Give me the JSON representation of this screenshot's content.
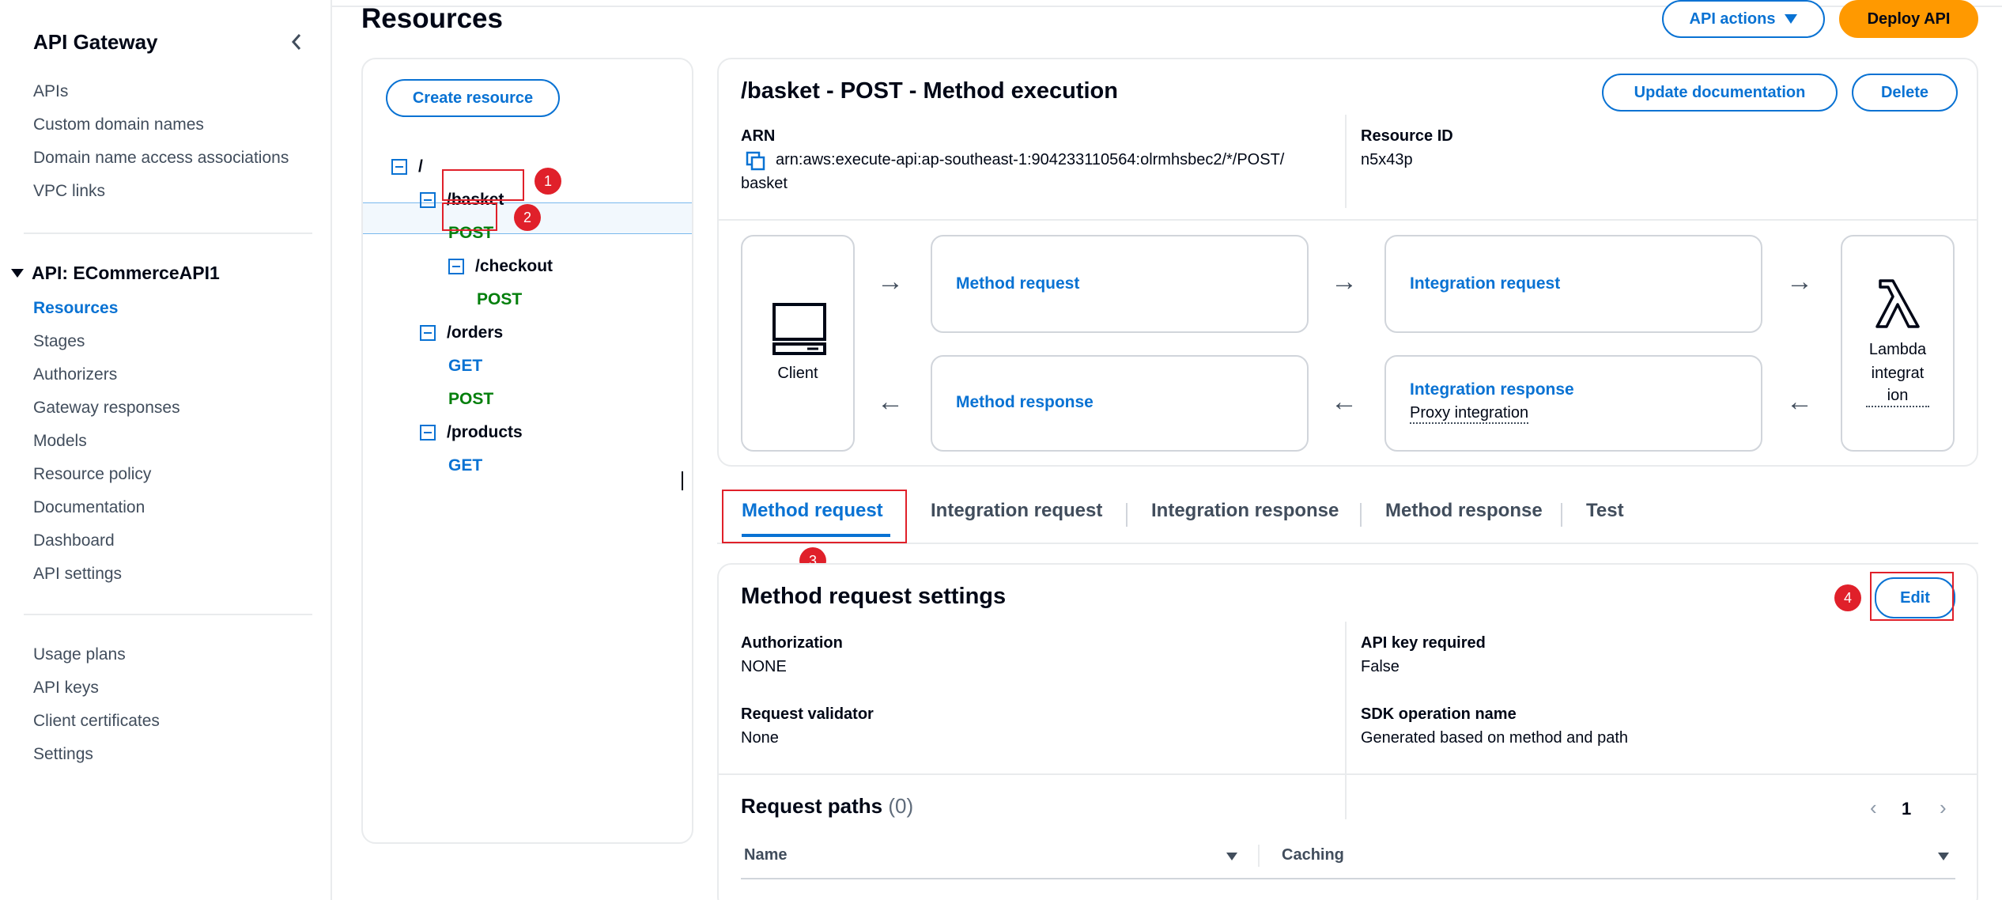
{
  "sidebar": {
    "title": "API Gateway",
    "top_items": [
      "APIs",
      "Custom domain names",
      "Domain name access associations",
      "VPC links"
    ],
    "api_group": "API: ECommerceAPI1",
    "api_items": [
      "Resources",
      "Stages",
      "Authorizers",
      "Gateway responses",
      "Models",
      "Resource policy",
      "Documentation",
      "Dashboard",
      "API settings"
    ],
    "bottom_items": [
      "Usage plans",
      "API keys",
      "Client certificates",
      "Settings"
    ]
  },
  "header": {
    "title": "Resources",
    "api_actions_label": "API actions",
    "deploy_label": "Deploy API"
  },
  "tree": {
    "create_label": "Create resource",
    "root": "/",
    "basket": "/basket",
    "basket_post": "POST",
    "checkout": "/checkout",
    "checkout_post": "POST",
    "orders": "/orders",
    "orders_get": "GET",
    "orders_post": "POST",
    "products": "/products",
    "products_get": "GET"
  },
  "annotations": [
    "1",
    "2",
    "3",
    "4"
  ],
  "execution": {
    "title": "/basket - POST - Method execution",
    "update_doc_label": "Update documentation",
    "delete_label": "Delete",
    "arn_label": "ARN",
    "arn_line1": "arn:aws:execute-api:ap-southeast-1:904233110564:olrmhsbec2/*/POST/",
    "arn_line2": "basket",
    "resource_id_label": "Resource ID",
    "resource_id": "n5x43p",
    "client_label": "Client",
    "method_request": "Method request",
    "integration_request": "Integration request",
    "method_response": "Method response",
    "integration_response": "Integration response",
    "proxy_integration": "Proxy integration",
    "lambda_line1": "Lambda",
    "lambda_line2": "integrat",
    "lambda_line3": "ion"
  },
  "tabs": [
    "Method request",
    "Integration request",
    "Integration response",
    "Method response",
    "Test"
  ],
  "settings": {
    "title": "Method request settings",
    "edit_label": "Edit",
    "authorization_label": "Authorization",
    "authorization": "NONE",
    "api_key_label": "API key required",
    "api_key": "False",
    "validator_label": "Request validator",
    "validator": "None",
    "sdk_label": "SDK operation name",
    "sdk": "Generated based on method and path",
    "paths_title": "Request paths",
    "paths_count": "(0)",
    "page": "1",
    "col_name": "Name",
    "col_caching": "Caching"
  },
  "colors": {
    "accent": "#0972d3",
    "primary_button": "#ff9900",
    "post_method": "#037f0c",
    "annotation": "#e0202a"
  }
}
